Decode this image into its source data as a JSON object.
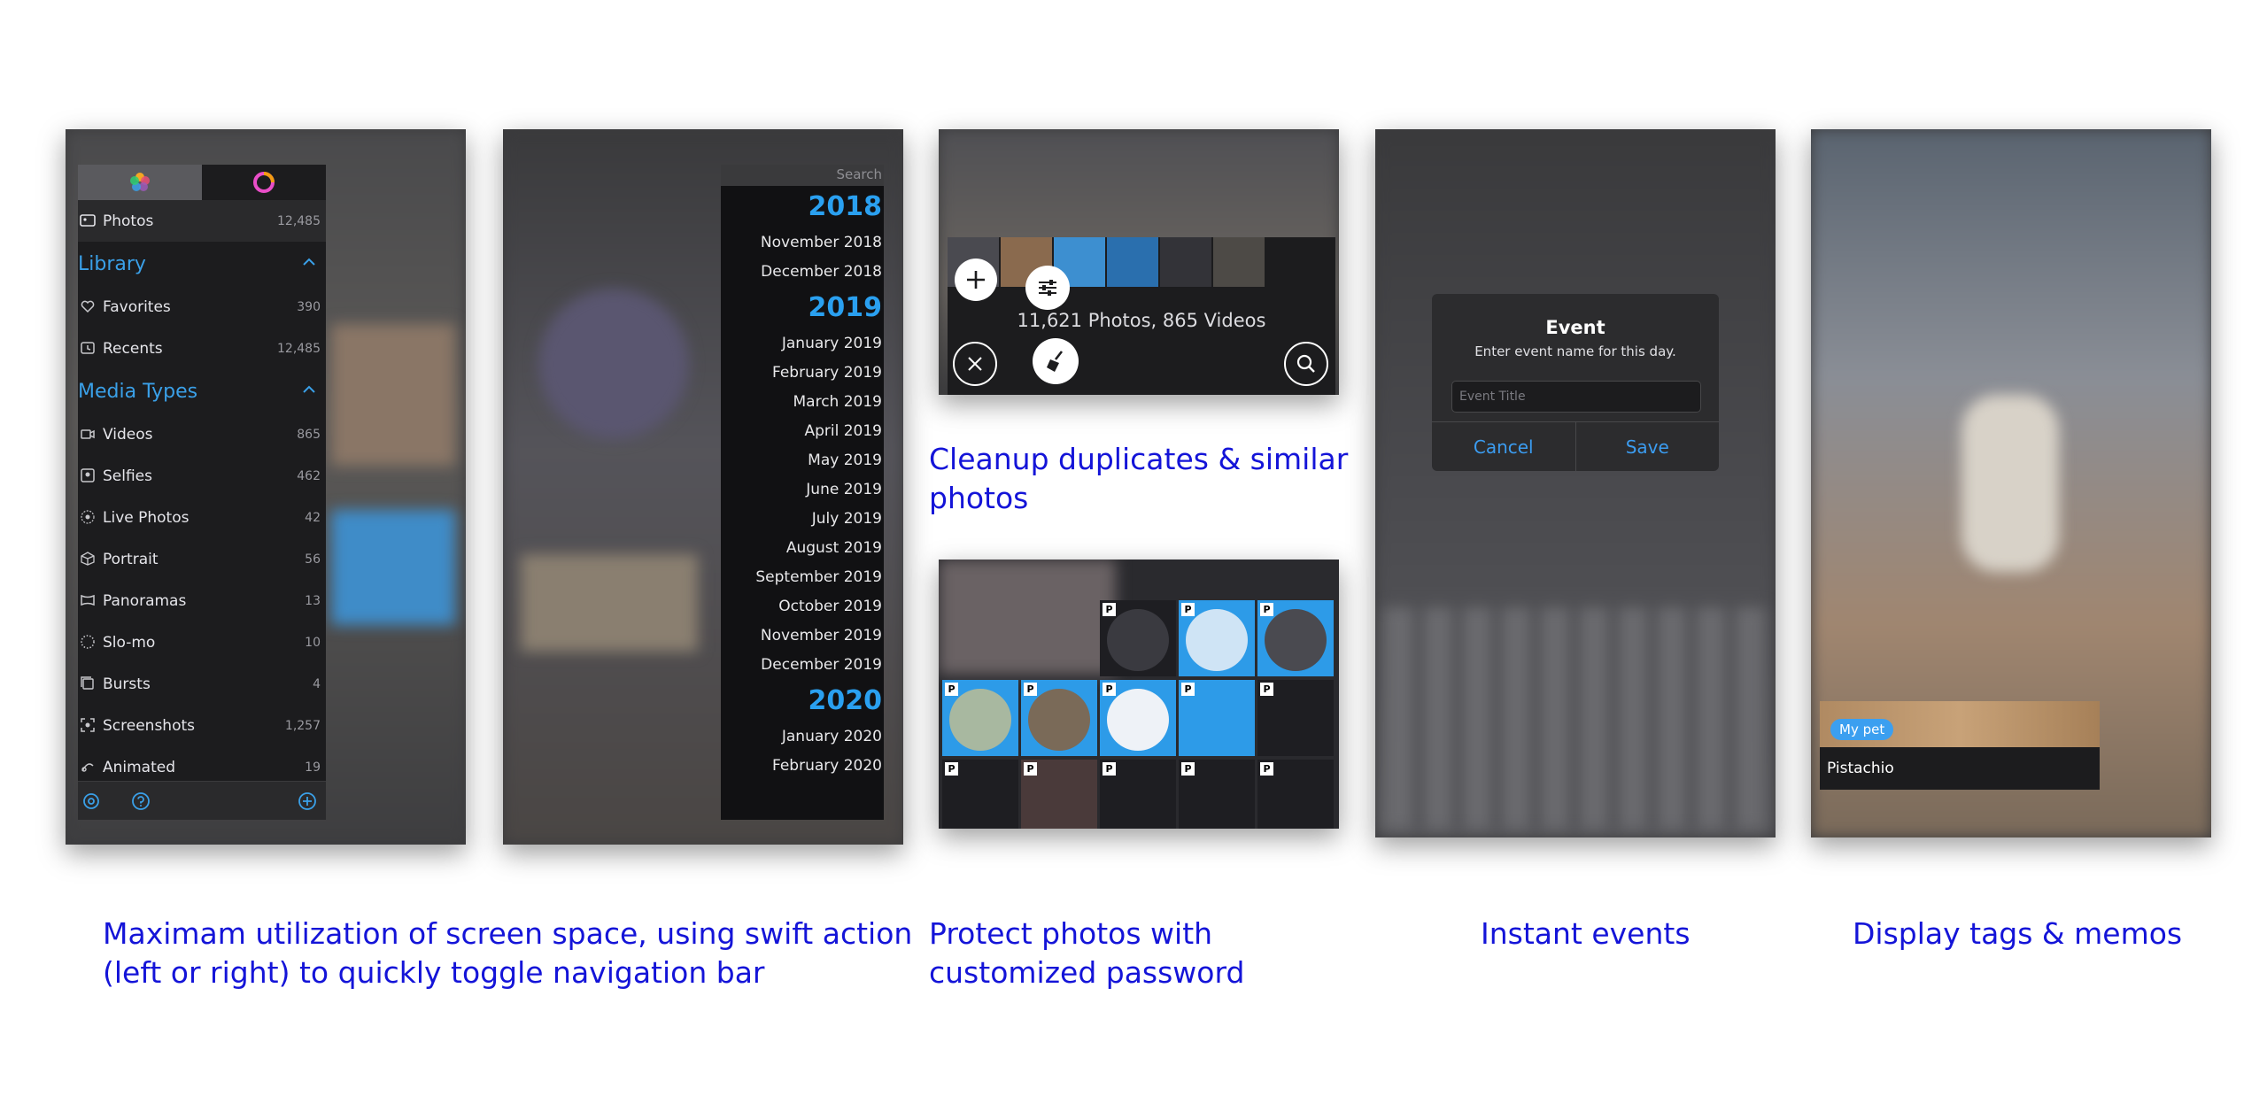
{
  "panels": {
    "navigation": {
      "sidebar": {
        "all_photos": {
          "label": "Photos",
          "count": "12,485"
        },
        "library_header": "Library",
        "library_items": [
          {
            "icon": "heart-icon",
            "label": "Favorites",
            "count": "390"
          },
          {
            "icon": "recents-icon",
            "label": "Recents",
            "count": "12,485"
          }
        ],
        "media_types_header": "Media Types",
        "media_items": [
          {
            "icon": "video-icon",
            "label": "Videos",
            "count": "865"
          },
          {
            "icon": "selfie-icon",
            "label": "Selfies",
            "count": "462"
          },
          {
            "icon": "live-photo-icon",
            "label": "Live Photos",
            "count": "42"
          },
          {
            "icon": "cube-icon",
            "label": "Portrait",
            "count": "56"
          },
          {
            "icon": "panorama-icon",
            "label": "Panoramas",
            "count": "13"
          },
          {
            "icon": "slomo-icon",
            "label": "Slo-mo",
            "count": "10"
          },
          {
            "icon": "burst-icon",
            "label": "Bursts",
            "count": "4"
          },
          {
            "icon": "screenshot-icon",
            "label": "Screenshots",
            "count": "1,257"
          },
          {
            "icon": "animated-icon",
            "label": "Animated",
            "count": "19"
          }
        ]
      },
      "timeline": {
        "search_placeholder": "Search",
        "year_2018": "2018",
        "months_2018": [
          "November 2018",
          "December 2018"
        ],
        "year_2019": "2019",
        "months_2019": [
          "January 2019",
          "February 2019",
          "March 2019",
          "April 2019",
          "May 2019",
          "June 2019",
          "July 2019",
          "August 2019",
          "September 2019",
          "October 2019",
          "November 2019",
          "December 2019"
        ],
        "year_2020": "2020",
        "months_2020": [
          "January 2020",
          "February 2020"
        ]
      },
      "caption_line1": "Maximam utilization of screen space, using swift action",
      "caption_line2": "(left or right) to quickly toggle navigation bar"
    },
    "cleanup": {
      "info": "11,621 Photos, 865 Videos",
      "caption_line1": "Cleanup duplicates & similar",
      "caption_line2": "photos"
    },
    "protect": {
      "badge": "P",
      "caption_line1": "Protect photos with",
      "caption_line2": "customized password"
    },
    "events": {
      "dialog_title": "Event",
      "dialog_message": "Enter event name for this day.",
      "input_placeholder": "Event Title",
      "cancel_label": "Cancel",
      "save_label": "Save",
      "caption": "Instant events"
    },
    "tags": {
      "tag_label": "My pet",
      "memo_text": "Pistachio",
      "caption": "Display tags & memos"
    }
  },
  "colors": {
    "caption": "#1414d8",
    "accent_blue": "#2aa0f0",
    "sidebar_bg": "#1c1c1e"
  }
}
